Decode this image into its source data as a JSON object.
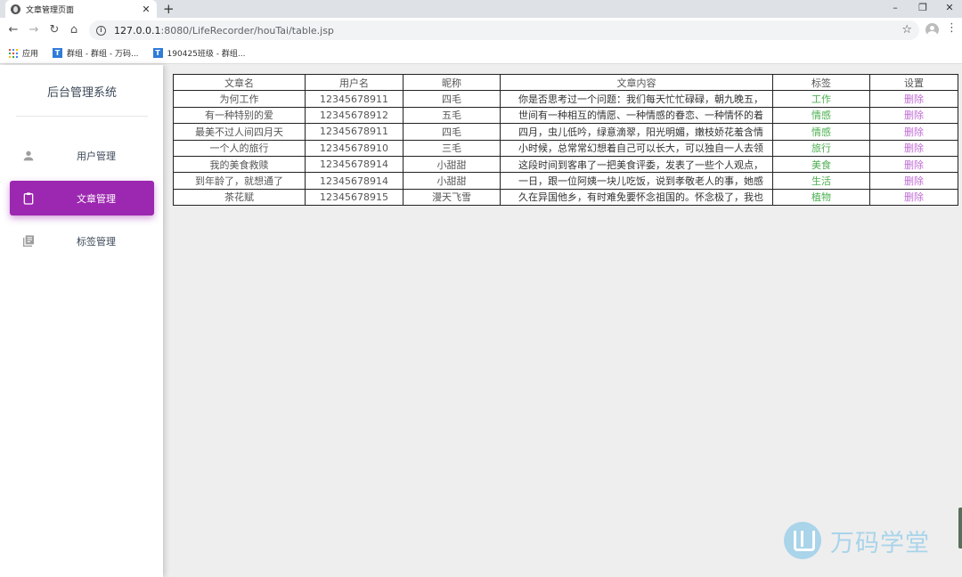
{
  "browser": {
    "tab_title": "文章管理页面",
    "tab_close": "✕",
    "new_tab": "+",
    "window_controls": {
      "minimize": "–",
      "restore": "❐",
      "close": "✕"
    },
    "nav": {
      "back": "←",
      "forward": "→",
      "reload": "↻",
      "home": "⌂"
    },
    "address": {
      "host": "127.0.0.1",
      "path": ":8080/LifeRecorder/houTai/table.jsp"
    },
    "bookmarks": [
      {
        "label": "应用",
        "icon": "apps-grid-icon"
      },
      {
        "label": "群组 - 群组 - 万码...",
        "icon": "bookmark-icon"
      },
      {
        "label": "190425班级 - 群组...",
        "icon": "bookmark-icon"
      }
    ],
    "bookmark_icon_glyph": "T",
    "menu_glyph": "⋮",
    "star_glyph": "☆"
  },
  "sidebar": {
    "brand": "后台管理系统",
    "items": [
      {
        "label": "用户管理",
        "icon": "person-icon",
        "active": false
      },
      {
        "label": "文章管理",
        "icon": "clipboard-icon",
        "active": true
      },
      {
        "label": "标签管理",
        "icon": "library-books-icon",
        "active": false
      }
    ],
    "active_color": "#9c27b0"
  },
  "table": {
    "headers": [
      "文章名",
      "用户名",
      "昵称",
      "文章内容",
      "标签",
      "设置"
    ],
    "rows": [
      [
        "为何工作",
        "12345678911",
        "四毛",
        "你是否思考过一个问题：我们每天忙忙碌碌，朝九晚五，",
        "工作",
        "删除"
      ],
      [
        "有一种特别的爱",
        "12345678912",
        "五毛",
        "世间有一种相互的情愿、一种情感的眷恋、一种情怀的着",
        "情感",
        "删除"
      ],
      [
        "最美不过人间四月天",
        "12345678911",
        "四毛",
        "四月，虫儿低吟，绿意滴翠，阳光明媚，嫩枝娇花羞含情",
        "情感",
        "删除"
      ],
      [
        "一个人的旅行",
        "12345678910",
        "三毛",
        "小时候，总常常幻想着自己可以长大，可以独自一人去领",
        "旅行",
        "删除"
      ],
      [
        "我的美食救赎",
        "12345678914",
        "小甜甜",
        "这段时间到客串了一把美食评委，发表了一些个人观点，",
        "美食",
        "删除"
      ],
      [
        "到年龄了，就想通了",
        "12345678914",
        "小甜甜",
        "一日，跟一位阿姨一块儿吃饭，说到孝敬老人的事，她感",
        "生活",
        "删除"
      ],
      [
        "茶花赋",
        "12345678915",
        "漫天飞雪",
        "久在异国他乡，有时难免要怀念祖国的。怀念极了，我也",
        "植物",
        "删除"
      ]
    ],
    "tag_color": "#4caf50",
    "delete_color": "#c06bd4"
  },
  "watermark": {
    "text": "万码学堂"
  }
}
